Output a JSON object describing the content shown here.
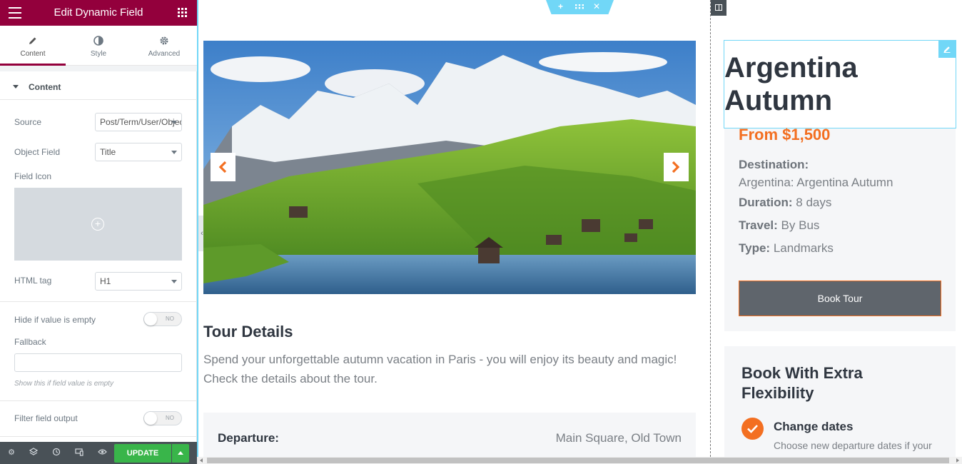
{
  "panel": {
    "title": "Edit Dynamic Field",
    "tabs": [
      {
        "label": "Content",
        "icon": "pencil-icon"
      },
      {
        "label": "Style",
        "icon": "half-circle-icon"
      },
      {
        "label": "Advanced",
        "icon": "gear-icon"
      }
    ],
    "section_title": "Content",
    "source_label": "Source",
    "source_value": "Post/Term/User/Object",
    "object_field_label": "Object Field",
    "object_field_value": "Title",
    "field_icon_label": "Field Icon",
    "html_tag_label": "HTML tag",
    "html_tag_value": "H1",
    "hide_empty_label": "Hide if value is empty",
    "hide_empty_state": "NO",
    "fallback_label": "Fallback",
    "fallback_value": "",
    "fallback_hint": "Show this if field value is empty",
    "filter_label": "Filter field output",
    "filter_state": "NO",
    "update_label": "UPDATE",
    "accent_color": "#93003c"
  },
  "tour": {
    "details_title": "Tour Details",
    "details_desc": "Spend your unforgettable autumn vacation in Paris - you will enjoy its beauty and magic! Check the details about the tour.",
    "departure_label": "Departure:",
    "departure_value": "Main Square, Old Town"
  },
  "sidebar": {
    "title": "Argentina Autumn",
    "price": "From $1,500",
    "destination_label": "Destination:",
    "destination_value": "Argentina: Argentina Autumn",
    "duration_label": "Duration:",
    "duration_value": "8 days",
    "travel_label": "Travel:",
    "travel_value": "By Bus",
    "type_label": "Type:",
    "type_value": "Landmarks",
    "book_label": "Book Tour",
    "flex_title": "Book With Extra Flexibility",
    "change_title": "Change dates",
    "change_desc": "Choose new departure dates if your plans change",
    "accent_color": "#f36f21"
  }
}
